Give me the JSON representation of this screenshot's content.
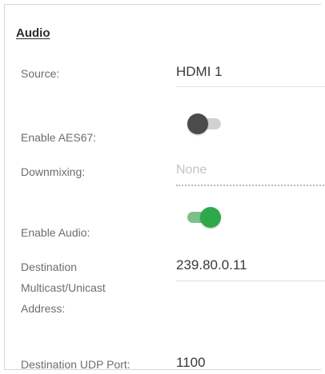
{
  "section": {
    "title": "Audio"
  },
  "fields": {
    "source": {
      "label": "Source:",
      "value": "HDMI 1"
    },
    "aes67": {
      "label": "Enable AES67:",
      "enabled": false
    },
    "downmixing": {
      "label": "Downmixing:",
      "value": "None"
    },
    "enable_audio": {
      "label": "Enable Audio:",
      "enabled": true
    },
    "destination_address": {
      "label_line1": "Destination",
      "label_line2": "Multicast/Unicast",
      "label_line3": "Address:",
      "value": "239.80.0.11"
    },
    "udp_port": {
      "label": "Destination UDP Port:",
      "value": "1100"
    }
  },
  "colors": {
    "toggle_on_track": "#7ec08a",
    "toggle_on_knob": "#2ea94a",
    "toggle_off_track": "#d2d2d2",
    "toggle_off_knob": "#4b4b4b"
  }
}
